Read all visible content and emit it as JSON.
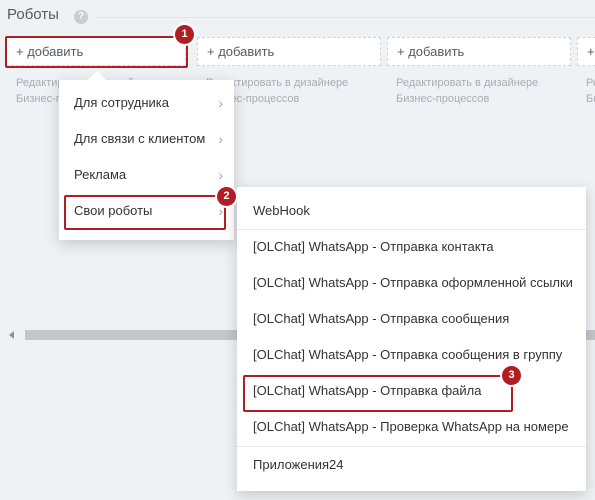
{
  "section": {
    "title": "Роботы",
    "help_icon": "question-icon"
  },
  "columns": [
    {
      "add_label": "+ добавить",
      "hint_line1": "Редактировать в дизайнере",
      "hint_line2": "Бизнес-процессов"
    },
    {
      "add_label": "+ добавить",
      "hint_line1": "Редактировать в дизайнере",
      "hint_line2": "Бизнес-процессов"
    },
    {
      "add_label": "+ добавить",
      "hint_line1": "Редактировать в дизайнере",
      "hint_line2": "Бизнес-процессов"
    },
    {
      "add_label": "+",
      "hint_line1": "Ре",
      "hint_line2": "Би"
    }
  ],
  "menu1": {
    "items": [
      {
        "label": "Для сотрудника"
      },
      {
        "label": "Для связи с клиентом"
      },
      {
        "label": "Реклама"
      },
      {
        "label": "Свои роботы"
      }
    ]
  },
  "menu2": {
    "items": [
      {
        "label": "WebHook"
      },
      {
        "label": "[OLChat] WhatsApp - Отправка контакта"
      },
      {
        "label": "[OLChat] WhatsApp - Отправка оформленной ссылки"
      },
      {
        "label": "[OLChat] WhatsApp - Отправка сообщения"
      },
      {
        "label": "[OLChat] WhatsApp - Отправка сообщения в группу"
      },
      {
        "label": "[OLChat] WhatsApp - Отправка файла"
      },
      {
        "label": "[OLChat] WhatsApp - Проверка WhatsApp на номере"
      },
      {
        "label": "Приложения24"
      }
    ]
  },
  "annotations": {
    "badge1": "1",
    "badge2": "2",
    "badge3": "3",
    "color": "#b01e23"
  }
}
